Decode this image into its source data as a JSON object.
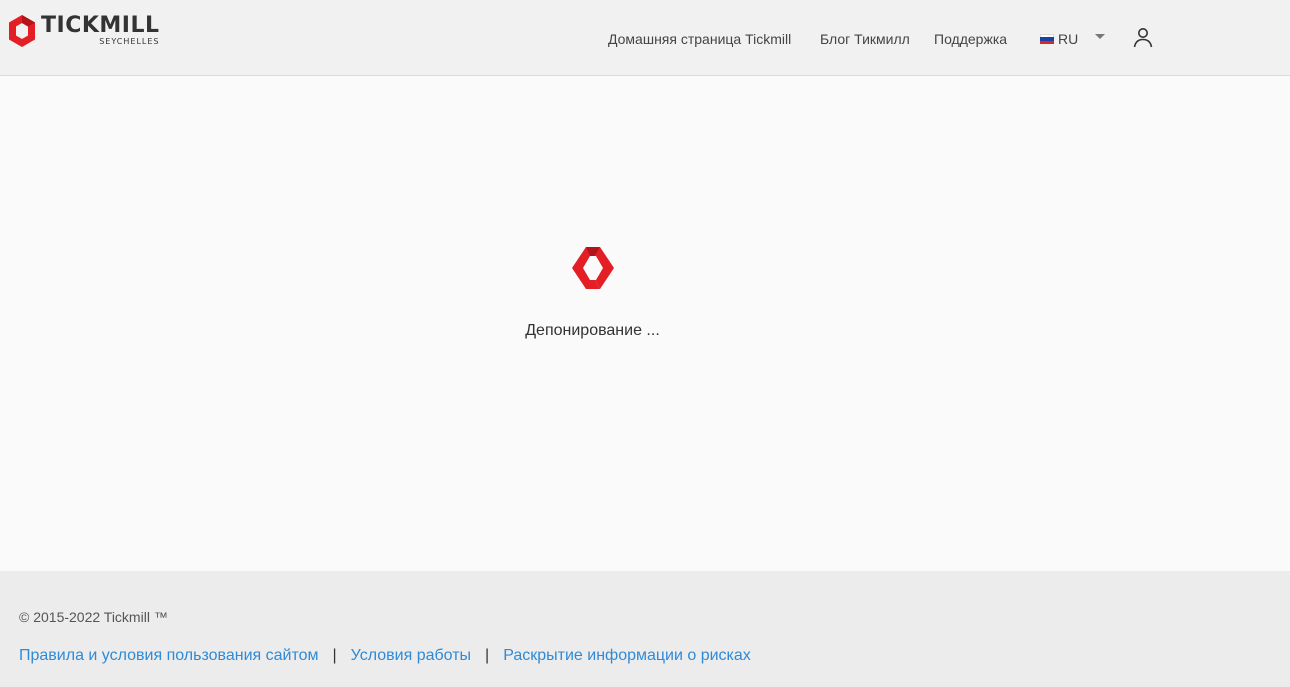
{
  "brand": {
    "name": "TICKMILL",
    "region": "SEYCHELLES",
    "color": "#e31e24"
  },
  "header": {
    "nav": [
      {
        "label": "Домашняя страница Tickmill"
      },
      {
        "label": "Блог Тикмилл"
      },
      {
        "label": "Поддержка"
      }
    ],
    "language": {
      "code": "RU",
      "flag_icon": "russia-flag-icon"
    },
    "user_icon": "user-icon"
  },
  "main": {
    "loader_icon": "tickmill-loader-icon",
    "status_text": "Депонирование ..."
  },
  "footer": {
    "copyright": "© 2015-2022 Tickmill ™",
    "links": [
      {
        "label": "Правила и условия пользования сайтом"
      },
      {
        "label": "Условия работы"
      },
      {
        "label": "Раскрытие информации о рисках"
      }
    ],
    "separator": "|",
    "link_color": "#2f8ad8"
  }
}
